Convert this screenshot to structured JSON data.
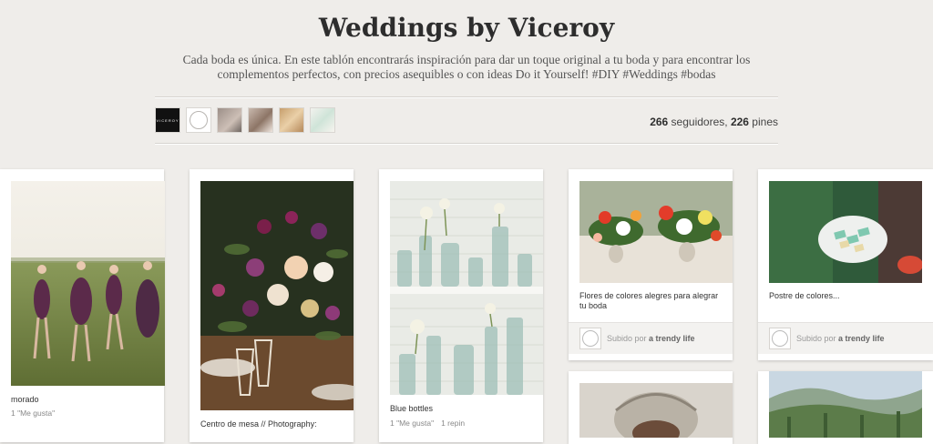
{
  "board": {
    "title": "Weddings by Viceroy",
    "description": "Cada boda es única. En este tablón encontrarás inspiración para dar un toque original a tu boda y para encontrar los complementos perfectos, con precios asequibles o con ideas Do it Yourself! #DIY #Weddings #bodas",
    "collaborators": [
      {
        "logo_text": "VICEROY",
        "icon": "viceroy-logo"
      },
      {
        "icon": "trendy-life-logo"
      },
      {
        "icon": "collaborator-photo"
      },
      {
        "icon": "collaborator-photo"
      },
      {
        "icon": "collaborator-photo"
      },
      {
        "icon": "collaborator-logo"
      }
    ],
    "stats": {
      "followers_count": "266",
      "followers_label": " seguidores, ",
      "pins_count": "226",
      "pins_label": " pines"
    }
  },
  "pins": [
    {
      "caption": "morado",
      "likes": "1 \"Me gusta\""
    },
    {
      "caption": "Centro de mesa // Photography:"
    },
    {
      "caption": "Blue bottles",
      "likes": "1 \"Me gusta\"",
      "repins": "1 repin"
    },
    {
      "caption": "Flores de colores alegres para alegrar tu boda",
      "attribution_prefix": "Subido por ",
      "attribution_name": "a trendy life"
    },
    {
      "caption": "Postre de colores...",
      "attribution_prefix": "Subido por ",
      "attribution_name": "a trendy life"
    }
  ]
}
